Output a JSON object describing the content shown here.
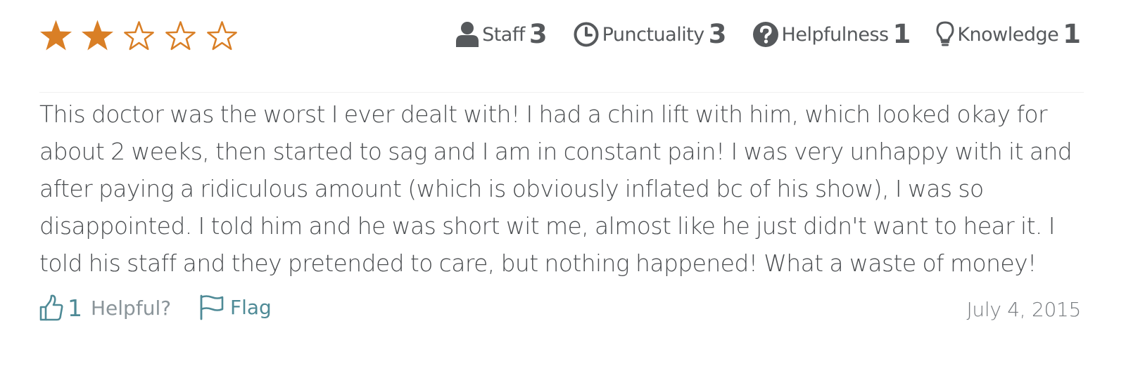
{
  "rating": {
    "stars_filled": 2,
    "stars_total": 5,
    "star_color": "#d97f26"
  },
  "categories": [
    {
      "label": "Staff",
      "value": "3",
      "icon": "user-icon"
    },
    {
      "label": "Punctuality",
      "value": "3",
      "icon": "clock-icon"
    },
    {
      "label": "Helpfulness",
      "value": "1",
      "icon": "question-circle-icon"
    },
    {
      "label": "Knowledge",
      "value": "1",
      "icon": "lightbulb-icon"
    }
  ],
  "review": {
    "text": "This doctor was the worst I ever dealt with! I had a chin lift with him, which looked okay for about 2 weeks, then started to sag and I am in constant pain! I was very unhappy with it and after paying a ridiculous amount (which is obviously inflated bc of his show), I was so disappointed. I told him and he was short wit me, almost like he just didn't want to hear it. I told his staff and they pretended to care, but nothing happened! What a waste of money!",
    "date": "July 4, 2015"
  },
  "footer": {
    "helpful_count": "1",
    "helpful_label": "Helpful?",
    "flag_label": "Flag",
    "link_color": "#4e8a96"
  }
}
